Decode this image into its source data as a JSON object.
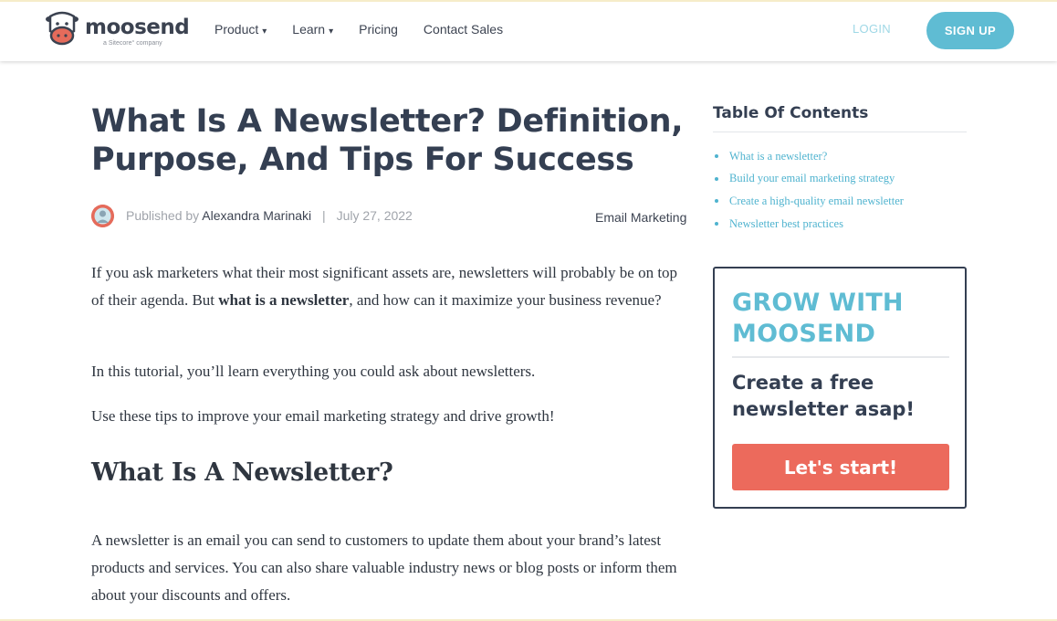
{
  "header": {
    "logo_word": "moosend",
    "logo_sub": "a Sitecore° company",
    "nav": [
      {
        "label": "Product",
        "caret": "▾"
      },
      {
        "label": "Learn",
        "caret": "▾"
      },
      {
        "label": "Pricing",
        "caret": ""
      },
      {
        "label": "Contact Sales",
        "caret": ""
      }
    ],
    "login_label": "LOGIN",
    "signup_label": "SIGN UP"
  },
  "article": {
    "title": "What Is A Newsletter? Definition, Purpose, And Tips For Success",
    "byline": {
      "published_by": "Published by",
      "author": "Alexandra Marinaki",
      "separator": "|",
      "date": "July 27, 2022",
      "category": "Email Marketing"
    },
    "p1_before": "If you ask marketers what their most significant assets are, newsletters will probably be on top of their agenda. But ",
    "p1_bold": "what is a newsletter",
    "p1_after": ", and how can it maximize your business revenue?",
    "p2": "In this tutorial, you’ll learn everything you could ask about newsletters.",
    "p3": "Use these tips to improve your email marketing strategy and drive growth!",
    "h2": "What Is A Newsletter?",
    "p4": "A newsletter is an email you can send to customers to update them about your brand’s latest products and services. You can also share valuable industry news or blog posts or inform them about your discounts and offers."
  },
  "toc": {
    "title": "Table Of Contents",
    "items": [
      "What is a newsletter?",
      "Build your email marketing strategy",
      "Create a high-quality email newsletter",
      "Newsletter best practices"
    ]
  },
  "cta": {
    "title": "GROW WITH MOOSEND",
    "subtitle": "Create a free newsletter asap!",
    "button": "Let's start!"
  },
  "colors": {
    "accent": "#5fbcd3",
    "cta_button": "#ec6a5c",
    "heading": "#343f52",
    "link": "#4fb3cf"
  }
}
